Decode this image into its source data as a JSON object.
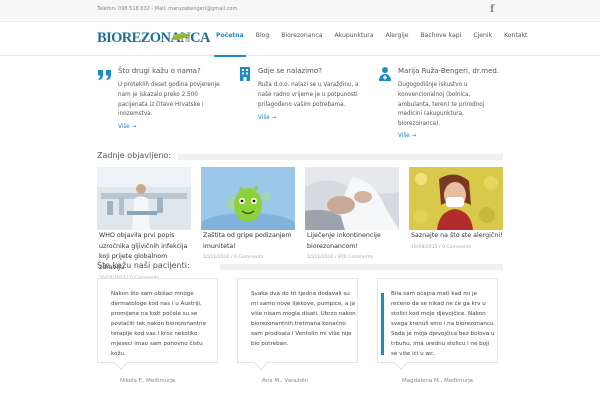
{
  "topbar": {
    "contact": "Telefon: 098 518 832 - Mail: maruzabengeri@gmail.com",
    "facebook_glyph": "f"
  },
  "logo": {
    "text": "BIOREZONANCA"
  },
  "nav": {
    "items": [
      {
        "label": "Početna",
        "active": true
      },
      {
        "label": "Blog"
      },
      {
        "label": "Biorezonanca"
      },
      {
        "label": "Akupunktura"
      },
      {
        "label": "Alergije"
      },
      {
        "label": "Bachove kapi"
      },
      {
        "label": "Cjenik"
      },
      {
        "label": "Kontakt"
      }
    ]
  },
  "features": [
    {
      "icon": "quote-icon",
      "title": "Što drugi kažu o nama?",
      "lines": [
        "U proteklih deset godina povjerenje",
        "nam je iskazalo preko 2.500",
        "pacijenata iz čitave Hrvatske i",
        "inozemstva."
      ],
      "more": "Više →"
    },
    {
      "icon": "building-icon",
      "title": "Gdje se nalazimo?",
      "lines": [
        "Ruža d.o.o. nalazi se u Varaždinu, a",
        "naše radno vrijeme je u potpunosti",
        "prilagođeno vašim potrebama."
      ],
      "more": "Više →"
    },
    {
      "icon": "doctor-icon",
      "title": "Marija Ruža-Bengeri, dr.med.",
      "lines": [
        "Dugogodišnje iskustvo u",
        "konvencionalnoj (bolnica,",
        "ambulanta, teren) te prirodnoj",
        "medicini (akupunktura,",
        "biorezonanca)."
      ],
      "more": "Više →"
    }
  ],
  "recent": {
    "title": "Zadnje objavljeno:",
    "posts": [
      {
        "title": "WHO objavila prvi popis uzročnika gljivičnih infekcija koji prijete globalnom zdravlju",
        "meta": "26/10/2022 / 0 Comments"
      },
      {
        "title": "Zaštita od gripe podizanjem imuniteta!",
        "meta": "10/11/2016 / 0 Comments"
      },
      {
        "title": "Liječenje inkontinencije biorezonancom!",
        "meta": "10/11/2016 / 870 Comments"
      },
      {
        "title": "Saznajte na što ste alergični!",
        "meta": "19/08/2015 / 0 Comments"
      }
    ]
  },
  "testimonials": {
    "title": "Što kažu naši pacijenti:",
    "items": [
      {
        "text": "Nakon što sam obišao mnoge dermatologe kod nas i u Austriji, promijene na koži počele su se povlačiti tek nakon biorezonantne terapije kod vas i kroz nekoliko mjeseci imao sam ponovno čistu kožu.",
        "author": "Nikola F., Međimurje"
      },
      {
        "text": "Svaka dva do tri tjedna dodavali su mi samo nove lijekove, pumpice, a ja više nisam mogla disati. Ubrzo nakon biorezonantnih tretmana konačno sam prodisala i Ventolin mi više nije bio potreban.",
        "author": "Ana M., Varaždin"
      },
      {
        "text": "Bila sam očajna mati kad mi je rečeno da se nikad ne će ga krv u stolici kod moje djevojčice. Nakon svega krenuli smo i na biorezonancu. Sada je moja djevojčica bez bolova u trbuhu, ima urednu stolicu i ne boji se više ići u wc.",
        "author": "Magdalena M., Međimurje"
      }
    ]
  },
  "colors": {
    "accent": "#1e8bc3",
    "logo": "#1d6f93",
    "text": "#555555"
  }
}
